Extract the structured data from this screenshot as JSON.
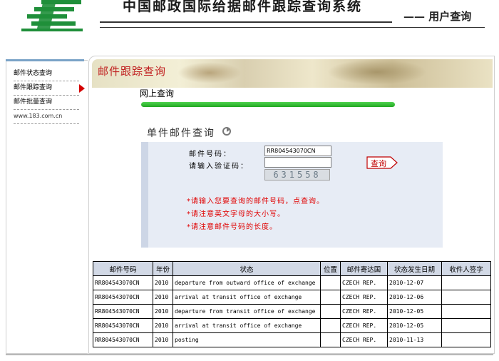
{
  "header": {
    "title": "中国邮政国际给据邮件跟踪查询系统",
    "subtitle": "—— 用户查询"
  },
  "sidebar": {
    "items": [
      {
        "label": "邮件状态查询"
      },
      {
        "label": "邮件跟踪查询",
        "active": true
      },
      {
        "label": "邮件批量查询"
      },
      {
        "label": "www.183.com.cn"
      }
    ]
  },
  "banner": {
    "title": "邮件跟踪查询"
  },
  "online_query_label": "网上查询",
  "single_query": {
    "title": "单件邮件查询",
    "mail_number_label": "邮件号码：",
    "mail_number_value": "RR804543070CN",
    "verify_code_label": "请输入验证码：",
    "verify_code_value": "",
    "captcha": "631558",
    "query_button": "查询",
    "notes": [
      "*请输入您要查询的邮件号码，点查询。",
      "*请注意英文字母的大小写。",
      "*请注意邮件号码的长度。"
    ]
  },
  "results": {
    "headers": [
      "邮件号码",
      "年份",
      "状态",
      "位置",
      "邮件寄达国",
      "状态发生日期",
      "收件人签字"
    ],
    "rows": [
      [
        "RR804543070CN",
        "2010",
        "departure from outward office of exchange",
        "",
        "CZECH REP.",
        "2010-12-07",
        ""
      ],
      [
        "RR804543070CN",
        "2010",
        "arrival at transit office of exchange",
        "",
        "CZECH REP.",
        "2010-12-06",
        ""
      ],
      [
        "RR804543070CN",
        "2010",
        "departure from transit office of exchange",
        "",
        "CZECH REP.",
        "2010-12-05",
        ""
      ],
      [
        "RR804543070CN",
        "2010",
        "arrival at transit office of exchange",
        "",
        "CZECH REP.",
        "2010-12-05",
        ""
      ],
      [
        "RR804543070CN",
        "2010",
        "posting",
        "",
        "CZECH REP.",
        "2010-11-13",
        ""
      ]
    ]
  },
  "colors": {
    "brand_green": "#1f8f3a",
    "banner_title": "#c02020",
    "note_red": "#e00000",
    "table_header_bg": "#d2d9e6",
    "form_bg": "#e7ecf5"
  },
  "icons": {
    "logo": "china-post-logo-icon",
    "arrow": "circular-arrow-icon",
    "active": "red-triangle-icon"
  }
}
